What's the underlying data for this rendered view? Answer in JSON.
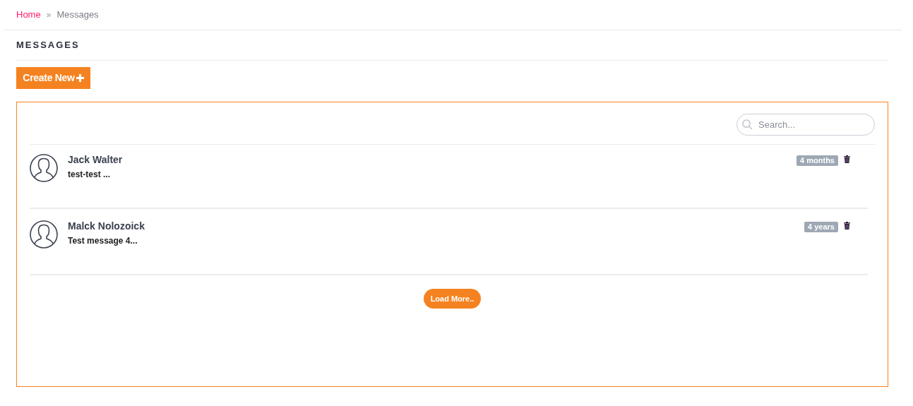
{
  "breadcrumb": {
    "items": [
      {
        "label": "Home",
        "kind": "link"
      },
      {
        "label": "Messages",
        "kind": "current"
      }
    ],
    "separator": "»"
  },
  "title": "MESSAGES",
  "create_button": "Create New",
  "search": {
    "placeholder": "Search..."
  },
  "messages": [
    {
      "name": "Jack Walter",
      "preview": "test-test ...",
      "age": "4 months"
    },
    {
      "name": "Malck Nolozoick",
      "preview": "Test message 4...",
      "age": "4 years"
    }
  ],
  "load_more": "Load More.."
}
